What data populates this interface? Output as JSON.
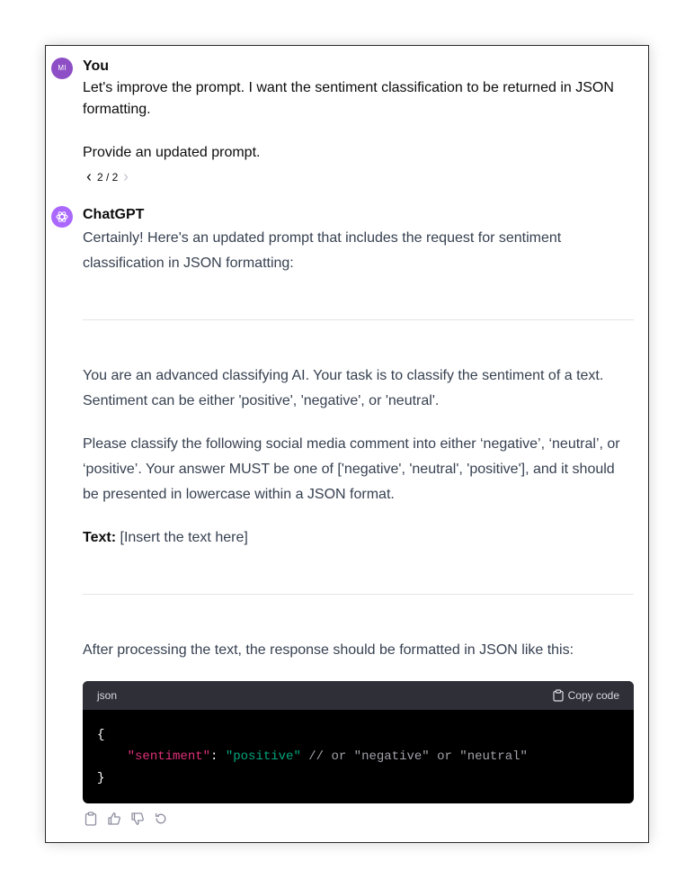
{
  "user": {
    "avatar_initials": "MI",
    "author": "You",
    "paragraphs": [
      "Let's improve the prompt. I want the sentiment classification to be returned in JSON formatting.",
      "Provide an updated prompt."
    ],
    "pager": {
      "text": "2 / 2"
    }
  },
  "assistant": {
    "author": "ChatGPT",
    "intro": "Certainly! Here's an updated prompt that includes the request for sentiment classification in JSON formatting:",
    "prompt_p1": "You are an advanced classifying AI. Your task is to classify the sentiment of a text. Sentiment can be either 'positive', 'negative', or 'neutral'.",
    "prompt_p2": "Please classify the following social media comment into either ‘negative’, ‘neutral’, or ‘positive’. Your answer MUST be one of ['negative', 'neutral', 'positive'], and it should be presented in lowercase within a JSON format.",
    "text_label": "Text:",
    "text_value": " [Insert the text here]",
    "after": "After processing the text, the response should be formatted in JSON like this:",
    "code": {
      "language": "json",
      "copy_label": "Copy code",
      "line1": "{",
      "indent": "    ",
      "key": "\"sentiment\"",
      "colon": ": ",
      "value": "\"positive\"",
      "comment": " // or \"negative\" or \"neutral\"",
      "line3": "}"
    },
    "actions": [
      "clipboard-icon",
      "thumbs-up-icon",
      "thumbs-down-icon",
      "regenerate-icon"
    ]
  },
  "colors": {
    "user_avatar": "#8e4ec6",
    "bot_avatar": "#ab68ff",
    "code_bg": "#000000",
    "code_header": "#2f2f38",
    "json_key": "#df3079",
    "json_string": "#00a67d"
  }
}
